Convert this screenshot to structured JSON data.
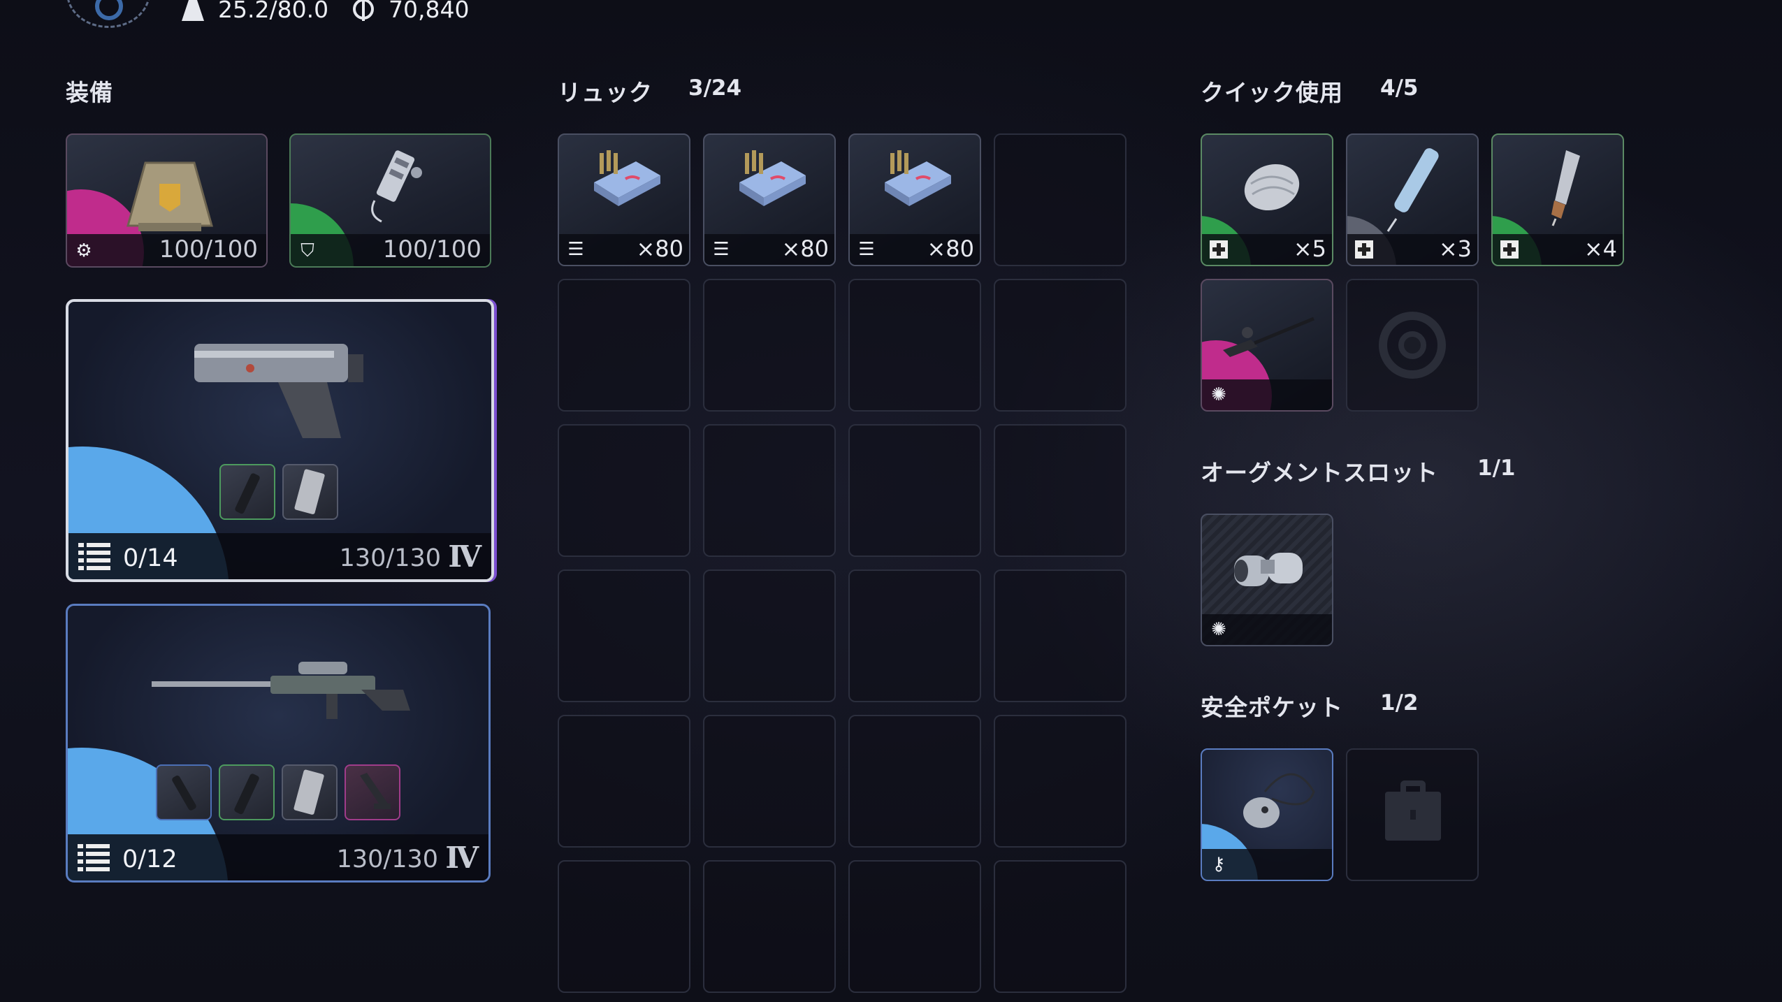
{
  "header": {
    "weight": "25.2/80.0",
    "currency": "70,840",
    "weight_icon": "weight-icon",
    "currency_icon": "coin-icon"
  },
  "equipment": {
    "title": "装備",
    "armor": [
      {
        "name": "backpack",
        "icon": "backpack-armor-icon",
        "value": "100/100",
        "accent": "#c02c8c"
      },
      {
        "name": "shield",
        "icon": "shield-gadget-icon",
        "value": "100/100",
        "accent": "#2f9e4c"
      }
    ],
    "weapons": [
      {
        "name": "pistol",
        "ammo": "0/14",
        "durability": "130/130",
        "tier": "Ⅳ"
      },
      {
        "name": "sniper-rifle",
        "ammo": "0/12",
        "durability": "130/130",
        "tier": "Ⅳ"
      }
    ]
  },
  "backpack": {
    "title": "リュック",
    "count": "3/24",
    "items": [
      {
        "name": "ammo-box",
        "count": "×80"
      },
      {
        "name": "ammo-box",
        "count": "×80"
      },
      {
        "name": "ammo-box",
        "count": "×80"
      }
    ]
  },
  "quick_use": {
    "title": "クイック使用",
    "count": "4/5",
    "items": [
      {
        "name": "bandage",
        "count": "×5"
      },
      {
        "name": "syringe",
        "count": "×3"
      },
      {
        "name": "injector",
        "count": "×4"
      },
      {
        "name": "grapple-tool",
        "count": ""
      }
    ]
  },
  "augment": {
    "title": "オーグメントスロット",
    "count": "1/1"
  },
  "safe_pocket": {
    "title": "安全ポケット",
    "count": "1/2"
  },
  "colors": {
    "rarity_pink": "#c02c8c",
    "rarity_green": "#2f9e4c",
    "rarity_blue": "#5aa8ea"
  }
}
